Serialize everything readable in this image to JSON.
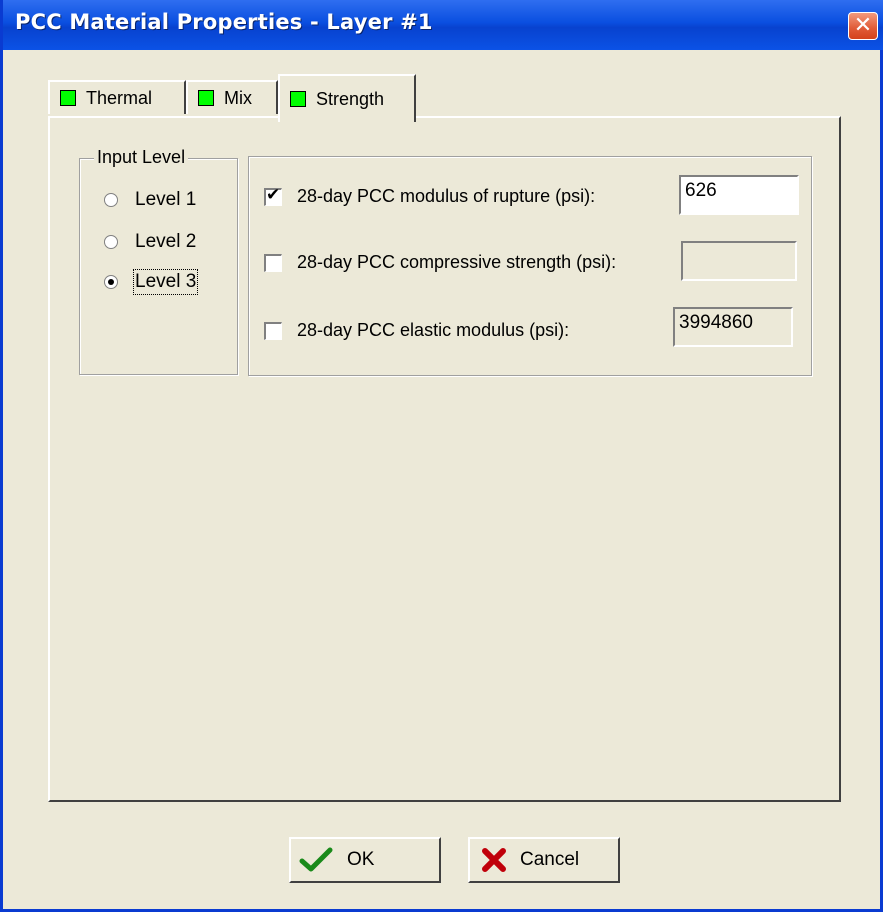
{
  "window": {
    "title": "PCC Material Properties - Layer #1",
    "close_glyph": "✕"
  },
  "tabs": [
    {
      "label": "Thermal",
      "indicator_color": "#00ff00",
      "active": false
    },
    {
      "label": "Mix",
      "indicator_color": "#00ff00",
      "active": false
    },
    {
      "label": "Strength",
      "indicator_color": "#00ff00",
      "active": true
    }
  ],
  "input_level": {
    "legend": "Input Level",
    "options": [
      "Level 1",
      "Level 2",
      "Level 3"
    ],
    "selected": "Level 3"
  },
  "properties": [
    {
      "label": "28-day PCC modulus of rupture (psi):",
      "checked": true,
      "value": "626"
    },
    {
      "label": "28-day PCC compressive strength (psi):",
      "checked": false,
      "value": ""
    },
    {
      "label": "28-day PCC elastic modulus (psi):",
      "checked": false,
      "value": "3994860"
    }
  ],
  "buttons": {
    "ok": "OK",
    "cancel": "Cancel"
  },
  "icons": {
    "ok": "checkmark-icon",
    "cancel": "red-x-icon",
    "check": "✔"
  },
  "colors": {
    "title_bar": "#0a4fe0",
    "dialog_bg": "#ece9d8",
    "close_button": "#e05a36",
    "tab_indicator": "#00ff00"
  }
}
